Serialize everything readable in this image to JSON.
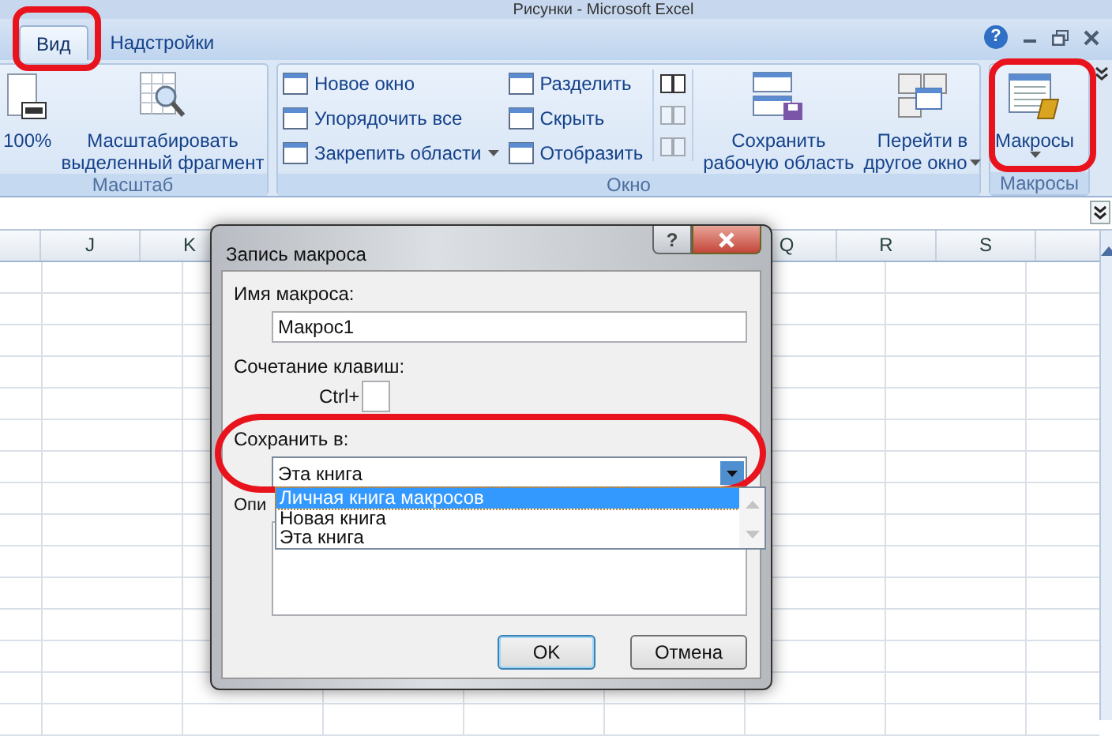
{
  "window": {
    "title": "Рисунки - Microsoft Excel",
    "help": "?"
  },
  "tabs": [
    {
      "label": "Вид",
      "selected": true
    },
    {
      "label": "Надстройки",
      "selected": false
    }
  ],
  "ribbon": [
    {
      "label": "Масштаб",
      "columns": [
        {
          "kind": "large",
          "lines": [
            "100%"
          ],
          "dropdown": false
        },
        {
          "kind": "large",
          "lines": [
            "Масштабировать",
            "выделенный фрагмент"
          ],
          "dropdown": false
        }
      ]
    },
    {
      "label": "Окно",
      "columns": [
        {
          "kind": "stack",
          "items": [
            {
              "label": "Новое окно",
              "dropdown": false
            },
            {
              "label": "Упорядочить все",
              "dropdown": false
            },
            {
              "label": "Закрепить области",
              "dropdown": true
            }
          ]
        },
        {
          "kind": "stack",
          "items": [
            {
              "label": "Разделить",
              "dropdown": false
            },
            {
              "label": "Скрыть",
              "dropdown": false
            },
            {
              "label": "Отобразить",
              "dropdown": false
            }
          ]
        },
        {
          "kind": "icons",
          "items": [
            {
              "disabled": false
            },
            {
              "disabled": true
            },
            {
              "disabled": true
            }
          ]
        },
        {
          "kind": "large",
          "lines": [
            "Сохранить",
            "рабочую область"
          ],
          "dropdown": false
        },
        {
          "kind": "large",
          "lines": [
            "Перейти в",
            "другое окно"
          ],
          "dropdown": true
        }
      ]
    },
    {
      "label": "Макросы",
      "columns": [
        {
          "kind": "large",
          "lines": [
            "Макросы"
          ],
          "dropdown": true
        }
      ]
    }
  ],
  "columns": [
    {
      "label": "J"
    },
    {
      "label": "K"
    },
    {
      "label": "Q"
    },
    {
      "label": "R"
    },
    {
      "label": "S"
    }
  ],
  "dialog": {
    "title": "Запись макроса",
    "help": "?",
    "name_label": "Имя макроса:",
    "name_value": "Макрос1",
    "shortcut_label": "Сочетание клавиш:",
    "shortcut_prefix": "Ctrl+",
    "store_label": "Сохранить в:",
    "store_value": "Эта книга",
    "store_options": [
      {
        "label": "Личная книга макросов",
        "selected": true
      },
      {
        "label": "Новая книга",
        "selected": false
      },
      {
        "label": "Эта книга",
        "selected": false
      }
    ],
    "description_label": "Опи",
    "buttons": [
      {
        "label": "OK",
        "default": true
      },
      {
        "label": "Отмена",
        "default": false
      }
    ]
  }
}
